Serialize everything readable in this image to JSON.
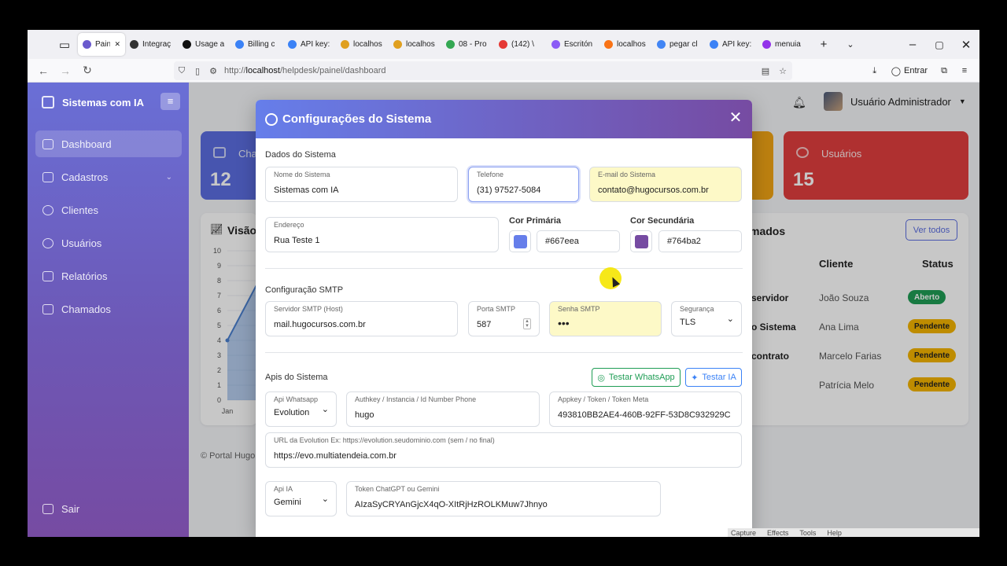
{
  "browser": {
    "tabs": [
      {
        "label": "Paine",
        "color": "#6a5acd",
        "active": true
      },
      {
        "label": "Integraç",
        "color": "#333333"
      },
      {
        "label": "Usage a",
        "color": "#111111"
      },
      {
        "label": "Billing c",
        "color": "#3b82f6"
      },
      {
        "label": "API key:",
        "color": "#3b82f6"
      },
      {
        "label": "localhos",
        "color": "#e0a020"
      },
      {
        "label": "localhos",
        "color": "#e0a020"
      },
      {
        "label": "08 - Pro",
        "color": "#34a853"
      },
      {
        "label": "(142) \\",
        "color": "#e53935"
      },
      {
        "label": "Escritón",
        "color": "#8b5cf6"
      },
      {
        "label": "localhos",
        "color": "#f97316"
      },
      {
        "label": "pegar cl",
        "color": "#4285f4"
      },
      {
        "label": "API key:",
        "color": "#3b82f6"
      },
      {
        "label": "menuia",
        "color": "#9333ea"
      }
    ],
    "url_prefix": "http://",
    "url_host": "localhost",
    "url_path": "/helpdesk/painel/dashboard",
    "signin_label": "Entrar"
  },
  "sidebar": {
    "brand": "Sistemas com IA",
    "items": [
      {
        "label": "Dashboard"
      },
      {
        "label": "Cadastros"
      },
      {
        "label": "Clientes"
      },
      {
        "label": "Usuários"
      },
      {
        "label": "Relatórios"
      },
      {
        "label": "Chamados"
      }
    ],
    "logout": "Sair"
  },
  "header": {
    "user_name": "Usuário Administrador"
  },
  "stats": {
    "first_label": "Cha",
    "first_value": "12",
    "users_label": "Usuários",
    "users_value": "15"
  },
  "chart_panel": {
    "title": "Visão",
    "yticks": [
      "10",
      "9",
      "8",
      "7",
      "6",
      "5",
      "4",
      "3",
      "2",
      "1",
      "0"
    ],
    "xtick": "Jan"
  },
  "chart_data": {
    "type": "area",
    "title": "Visão",
    "categories": [
      "Jan"
    ],
    "series": [
      {
        "values": [
          4
        ]
      }
    ],
    "ylim": [
      0,
      10
    ]
  },
  "calls": {
    "title": "mados",
    "view_all": "Ver todos",
    "col_client": "Cliente",
    "col_status": "Status",
    "rows": [
      {
        "subject": "servidor",
        "client": "João Souza",
        "status": "Aberto",
        "kind": "open"
      },
      {
        "subject": "o Sistema",
        "client": "Ana Lima",
        "status": "Pendente",
        "kind": "pend"
      },
      {
        "subject": "contrato",
        "client": "Marcelo Farias",
        "status": "Pendente",
        "kind": "pend"
      },
      {
        "subject": "",
        "client": "Patrícia Melo",
        "status": "Pendente",
        "kind": "pend"
      }
    ]
  },
  "footer": "© Portal Hugo",
  "modal": {
    "title": "Configurações do Sistema",
    "section_dados": "Dados do Sistema",
    "nome_label": "Nome do Sistema",
    "nome_value": "Sistemas com IA",
    "telefone_label": "Telefone",
    "telefone_value": "(31) 97527-5084",
    "email_label": "E-mail do Sistema",
    "email_value": "contato@hugocursos.com.br",
    "endereco_label": "Endereço",
    "endereco_value": "Rua Teste 1",
    "cor_primaria_label": "Cor Primária",
    "cor_primaria": "#667eea",
    "cor_secundaria_label": "Cor Secundária",
    "cor_secundaria": "#764ba2",
    "section_smtp": "Configuração SMTP",
    "smtp_host_label": "Servidor SMTP (Host)",
    "smtp_host_value": "mail.hugocursos.com.br",
    "smtp_port_label": "Porta SMTP",
    "smtp_port_value": "587",
    "smtp_pass_label": "Senha SMTP",
    "smtp_pass_value": "•••",
    "smtp_sec_label": "Segurança",
    "smtp_sec_value": "TLS",
    "section_apis": "Apis do Sistema",
    "btn_whatsapp": "Testar WhatsApp",
    "btn_ia": "Testar IA",
    "api_wa_label": "Api Whatsapp",
    "api_wa_value": "Evolution",
    "authkey_label": "Authkey / Instancia / Id Number Phone",
    "authkey_value": "hugo",
    "appkey_label": "Appkey / Token / Token Meta",
    "appkey_value": "493810BB2AE4-460B-92FF-53D8C932929C",
    "evo_url_label": "URL da Evolution Ex: https://evolution.seudominio.com (sem / no final)",
    "evo_url_value": "https://evo.multiatendeia.com.br",
    "api_ia_label": "Api IA",
    "api_ia_value": "Gemini",
    "token_label": "Token ChatGPT ou Gemini",
    "token_value": "AIzaSyCRYAnGjcX4qO-XItRjHzROLKMuw7Jhnyo"
  },
  "taskbar_hint": [
    "Capture",
    "Effects",
    "Tools",
    "Help"
  ]
}
